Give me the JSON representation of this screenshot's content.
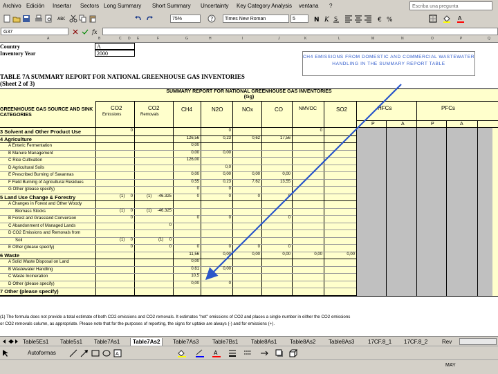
{
  "menu": [
    "Archivo",
    "Edición",
    "Insertar",
    "Sectors",
    "Long Summary",
    "Short Summary",
    "Uncertainty",
    "Key Category Analysis",
    "ventana",
    "?"
  ],
  "help_placeholder": "Escriba una pregunta",
  "toolbar": {
    "zoom": "75%",
    "font": "Times New Roman",
    "size": "5"
  },
  "name_box": "G37",
  "columns": [
    "A",
    "B",
    "C",
    "D",
    "E",
    "F",
    "G",
    "H",
    "I",
    "J",
    "K",
    "L",
    "M",
    "N",
    "O",
    "P",
    "Q"
  ],
  "country_label": "Country",
  "country_value": "A",
  "inventory_year_label": "Inventory Year",
  "inventory_year_value": "2000",
  "report_title": "TABLE 7A SUMMARY REPORT FOR NATIONAL GREENHOUSE GAS INVENTORIES",
  "report_sheet": "(Sheet 2 of 3)",
  "table_title": "SUMMARY REPORT FOR NATIONAL GREENHOUSE GAS INVENTORIES",
  "table_unit": "(Gg)",
  "callout": "CH4 EMISSIONS FROM DOMESTIC AND COMMERCIAL WASTEWATER HANDLING IN THE SUMMARY REPORT TABLE",
  "header": {
    "category": "GREENHOUSE GAS SOURCE AND SINK CATEGORIES",
    "co2": "CO2",
    "co2_sub": "Emissions",
    "co2r": "CO2",
    "co2r_sub": "Removals",
    "ch4": "CH4",
    "n2o": "N2O",
    "nox": "NOx",
    "co": "CO",
    "nmvoc": "NMVOC",
    "so2": "SO2",
    "hfcs": "HFCs",
    "pfcs": "PFCs",
    "p1": "P",
    "a1": "A",
    "p2": "P",
    "a2": "A"
  },
  "rows": [
    {
      "label": "3 Solvent and Other Product Use",
      "co2e": "0",
      "co2r": "",
      "ch4": "",
      "n2o": "0",
      "nox": "",
      "co": "",
      "nmvoc": "0",
      "so2": ""
    },
    {
      "label": "4 Agriculture",
      "co2e": "",
      "co2r": "",
      "ch4": "126,56",
      "n2o": "0,23",
      "nox": "0,62",
      "co": "17,56",
      "nmvoc": "",
      "so2": ""
    },
    {
      "label": "A Enteric Fermentation",
      "co2e": "",
      "co2r": "",
      "ch4": "0,00",
      "n2o": "",
      "nox": "",
      "co": "",
      "nmvoc": "",
      "so2": ""
    },
    {
      "label": "B Manure Management",
      "co2e": "",
      "co2r": "",
      "ch4": "0,00",
      "n2o": "0,00",
      "nox": "",
      "co": "",
      "nmvoc": "",
      "so2": ""
    },
    {
      "label": "C Rice Cultivation",
      "co2e": "",
      "co2r": "",
      "ch4": "126,00",
      "n2o": "",
      "nox": "",
      "co": "",
      "nmvoc": "",
      "so2": ""
    },
    {
      "label": "D Agricultural Soils",
      "co2e": "",
      "co2r": "",
      "ch4": "",
      "n2o": "0,0",
      "nox": "",
      "co": "",
      "nmvoc": "",
      "so2": ""
    },
    {
      "label": "E Prescribed Burning of Savannas",
      "co2e": "",
      "co2r": "",
      "ch4": "0,00",
      "n2o": "0,00",
      "nox": "0,00",
      "co": "0,00",
      "nmvoc": "",
      "so2": ""
    },
    {
      "label": "F Field Burning of Agricultural Residues",
      "co2e": "",
      "co2r": "",
      "ch4": "0,55",
      "n2o": "0,23",
      "nox": "7,62",
      "co": "13,55",
      "nmvoc": "",
      "so2": ""
    },
    {
      "label": "G Other (please specify)",
      "co2e": "",
      "co2r": "",
      "ch4": "0",
      "n2o": "0",
      "nox": "",
      "co": "",
      "nmvoc": "",
      "so2": ""
    },
    {
      "label": "5 Land Use Change & Forestry",
      "co2e": "(1)     0",
      "co2r": "(1)     -46.325",
      "ch4": "0",
      "n2o": "0",
      "nox": "0",
      "co": "0",
      "nmvoc": "",
      "so2": ""
    },
    {
      "label": "A Changes in Forest and Other Woody",
      "co2e": "",
      "co2r": "",
      "ch4": "",
      "n2o": "",
      "nox": "",
      "co": "",
      "nmvoc": "",
      "so2": ""
    },
    {
      "label": "Biomass Stocks",
      "co2e": "(1)     0",
      "co2r": "(1)     -46.325",
      "ch4": "",
      "n2o": "",
      "nox": "",
      "co": "",
      "nmvoc": "",
      "so2": ""
    },
    {
      "label": "B Forest and Grassland Conversion",
      "co2e": "0",
      "co2r": "",
      "ch4": "0",
      "n2o": "0",
      "nox": "",
      "co": "0",
      "nmvoc": "",
      "so2": ""
    },
    {
      "label": "C Abandonment of Managed Lands",
      "co2e": "",
      "co2r": "0",
      "ch4": "",
      "n2o": "",
      "nox": "",
      "co": "",
      "nmvoc": "",
      "so2": ""
    },
    {
      "label": "D CO2 Emissions and Removals from",
      "co2e": "",
      "co2r": "",
      "ch4": "",
      "n2o": "",
      "nox": "",
      "co": "",
      "nmvoc": "",
      "so2": ""
    },
    {
      "label": "Soil",
      "co2e": "(1)     0",
      "co2r": "(1)     0",
      "ch4": "",
      "n2o": "",
      "nox": "",
      "co": "",
      "nmvoc": "",
      "so2": ""
    },
    {
      "label": "E Other (please specify)",
      "co2e": "0",
      "co2r": "0",
      "ch4": "0",
      "n2o": "0",
      "nox": "0",
      "co": "0",
      "nmvoc": "",
      "so2": ""
    },
    {
      "label": "6 Waste",
      "co2e": "",
      "co2r": "",
      "ch4": "11,56",
      "n2o": "0,00",
      "nox": "0,00",
      "co": "0,00",
      "nmvoc": "0,00",
      "so2": "0,00"
    },
    {
      "label": "A Solid Waste Disposal on Land",
      "co2e": "",
      "co2r": "",
      "ch4": "0,00",
      "n2o": "",
      "nox": "",
      "co": "",
      "nmvoc": "",
      "so2": ""
    },
    {
      "label": "B Wastewater Handling",
      "co2e": "",
      "co2r": "",
      "ch4": "0,61",
      "n2o": "0,00",
      "nox": "",
      "co": "",
      "nmvoc": "",
      "so2": ""
    },
    {
      "label": "C Waste Incineration",
      "co2e": "",
      "co2r": "",
      "ch4": "10,5",
      "n2o": "",
      "nox": "",
      "co": "",
      "nmvoc": "",
      "so2": ""
    },
    {
      "label": "D Other (please specify)",
      "co2e": "",
      "co2r": "",
      "ch4": "0,00",
      "n2o": "0",
      "nox": "",
      "co": "",
      "nmvoc": "",
      "so2": ""
    },
    {
      "label": "7 Other (please specify)",
      "co2e": "",
      "co2r": "",
      "ch4": "",
      "n2o": "",
      "nox": "",
      "co": "",
      "nmvoc": "",
      "so2": ""
    }
  ],
  "footnote1": "(1) The formula does not provide a total estimate of both CO2 emissions and CO2 removals. It estimates \"net\" emissions of CO2 and places a single number in either the CO2 emissions",
  "footnote2": "or CO2 removals column, as appropriate. Please note that for the purposes of reporting, the signs for uptake are always (-) and for emissions (+).",
  "tabs": [
    "Table5Es1",
    "Table5s1",
    "Table7As1",
    "Table7As2",
    "Table7As3",
    "Table7Bs1",
    "Table8As1",
    "Table8As2",
    "Table8As3",
    "17CF.8_1",
    "17CF.8_2",
    "Rev"
  ],
  "active_tab": "Table7As2",
  "autoshapes": "Autoformas",
  "status": "MAY"
}
